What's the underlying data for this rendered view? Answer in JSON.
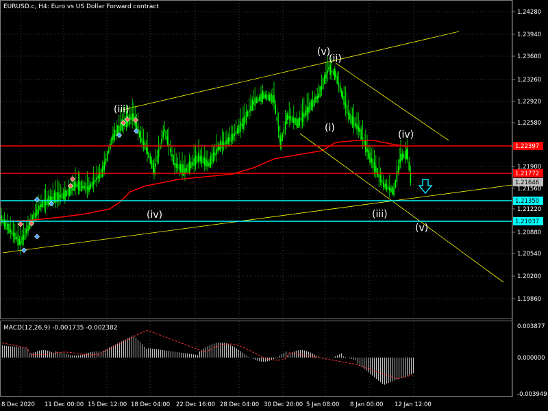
{
  "header": {
    "symbol_line": "EURUSD.c, H4:  Euro vs US Dollar Forward contract"
  },
  "macd_header": "MACD(12,26,9) -0.001735 -0.002382",
  "price_axis": {
    "labels": [
      "1.24280",
      "1.23940",
      "1.23600",
      "1.23260",
      "1.22920",
      "1.22580",
      "1.22240",
      "1.21900",
      "1.21560",
      "1.21220",
      "1.20880",
      "1.20540",
      "1.20200",
      "1.19860"
    ]
  },
  "macd_axis": {
    "labels": [
      "0.003877",
      "0.000000",
      "-0.003949"
    ]
  },
  "time_axis": {
    "labels": [
      "8 Dec 2020",
      "11 Dec 00:00",
      "15 Dec 12:00",
      "18 Dec 04:00",
      "22 Dec 16:00",
      "28 Dec 04:00",
      "30 Dec 20:00",
      "5 Jan 08:00",
      "8 Jan 00:00",
      "12 Jan 12:00"
    ]
  },
  "price_tags": [
    {
      "label": "1.22397",
      "color": "#ff0000"
    },
    {
      "label": "1.21772",
      "color": "#ff0000"
    },
    {
      "label": "1.21646",
      "color": "#c0c0c0"
    },
    {
      "label": "1.21350",
      "color": "#00ffff"
    },
    {
      "label": "1.21037",
      "color": "#00ffff"
    }
  ],
  "wave_labels": [
    "(iii)",
    "(v)",
    "(ii)",
    "(i)",
    "(iv)",
    "(iv)",
    "(iii)",
    "(v)"
  ],
  "colors": {
    "candle": "#00ff00",
    "ma": "#ff0000",
    "trend": "#ffff00",
    "support": "#00ffff",
    "resistance": "#ff0000",
    "grid": "#404040"
  }
}
